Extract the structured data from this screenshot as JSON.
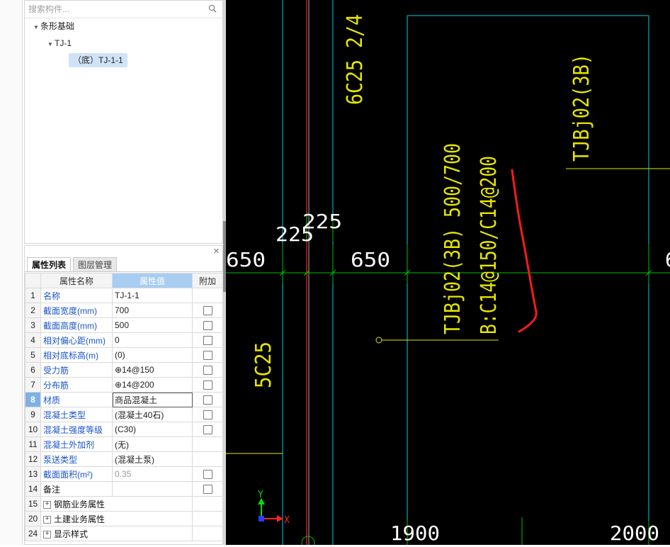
{
  "tree": {
    "search_placeholder": "搜索构件...",
    "nodes": [
      {
        "label": "条形基础"
      },
      {
        "label": "TJ-1"
      },
      {
        "label": "（底）TJ-1-1"
      }
    ]
  },
  "props": {
    "tabs": [
      "属性列表",
      "图层管理"
    ],
    "headers": {
      "name": "属性名称",
      "value": "属性值",
      "extra": "附加"
    },
    "rows": [
      {
        "num": "1",
        "name": "名称",
        "value": "TJ-1-1"
      },
      {
        "num": "2",
        "name": "截面宽度(mm)",
        "value": "700"
      },
      {
        "num": "3",
        "name": "截面高度(mm)",
        "value": "500"
      },
      {
        "num": "4",
        "name": "相对偏心距(mm)",
        "value": "0"
      },
      {
        "num": "5",
        "name": "相对底标高(m)",
        "value": "(0)"
      },
      {
        "num": "6",
        "name": "受力筋",
        "value": "⊕14@150"
      },
      {
        "num": "7",
        "name": "分布筋",
        "value": "⊕14@200"
      },
      {
        "num": "8",
        "name": "材质",
        "value": "商品混凝土"
      },
      {
        "num": "9",
        "name": "混凝土类型",
        "value": "(混凝土40石)"
      },
      {
        "num": "10",
        "name": "混凝土强度等级",
        "value": "(C30)"
      },
      {
        "num": "11",
        "name": "混凝土外加剂",
        "value": "(无)"
      },
      {
        "num": "12",
        "name": "泵送类型",
        "value": "(混凝土泵)"
      },
      {
        "num": "13",
        "name": "截面面积(m²)",
        "value": "0.35"
      },
      {
        "num": "14",
        "name": "备注",
        "value": ""
      },
      {
        "num": "15",
        "name": "钢筋业务属性",
        "value": ""
      },
      {
        "num": "20",
        "name": "土建业务属性",
        "value": ""
      },
      {
        "num": "24",
        "name": "显示样式",
        "value": ""
      }
    ]
  },
  "cad": {
    "labels": {
      "rebar_top": "6C25 2/4",
      "beam_label_right": "TJBj02(3B)",
      "beam_label_main": "TJBj02(3B) 500/700",
      "beam_rebar": "B:C14@150/C14@200",
      "rebar_left": "5C25",
      "dim_225_a": "225",
      "dim_225_b": "225",
      "dim_650_left": "650",
      "dim_650_mid": "650",
      "dim_right_partial": "6",
      "dim_1900": "1900",
      "dim_2000": "2000",
      "axis_y": "Y",
      "axis_x": "X"
    },
    "colors": {
      "background": "#000000",
      "cyan": "#00cfe0",
      "red": "#ff2020",
      "yellow": "#e6e600",
      "green": "#00c000",
      "white": "#ffffff",
      "markup": "#ff1a1a"
    }
  }
}
